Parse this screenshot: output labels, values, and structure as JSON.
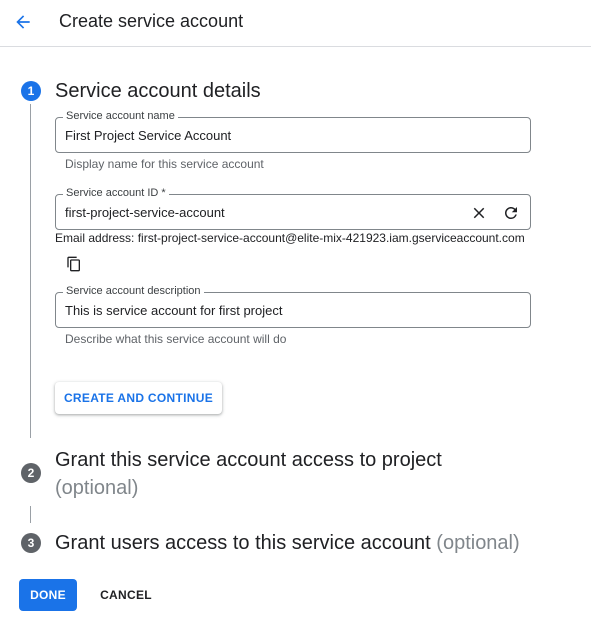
{
  "header": {
    "back_icon": "arrow-back-icon",
    "title": "Create service account"
  },
  "steps": [
    {
      "number": "1",
      "title": "Service account details",
      "optional": ""
    },
    {
      "number": "2",
      "title": "Grant this service account access to project",
      "optional": "(optional)"
    },
    {
      "number": "3",
      "title": "Grant users access to this service account",
      "optional": "(optional)"
    }
  ],
  "form": {
    "name": {
      "label": "Service account name",
      "value": "First Project Service Account",
      "hint": "Display name for this service account"
    },
    "account_id": {
      "label": "Service account ID *",
      "value": "first-project-service-account",
      "clear_icon": "close-icon",
      "refresh_icon": "refresh-icon"
    },
    "email_text": "Email address: first-project-service-account@elite-mix-421923.iam.gserviceaccount.com",
    "copy_icon": "copy-icon",
    "description": {
      "label": "Service account description",
      "value": "This is service account for first project",
      "hint": "Describe what this service account will do"
    },
    "create_button": "CREATE AND CONTINUE"
  },
  "footer": {
    "done_button": "DONE",
    "cancel_button": "CANCEL"
  },
  "colors": {
    "accent": "#1a73e8",
    "inactive_step": "#5f6368",
    "border": "#80868b"
  }
}
